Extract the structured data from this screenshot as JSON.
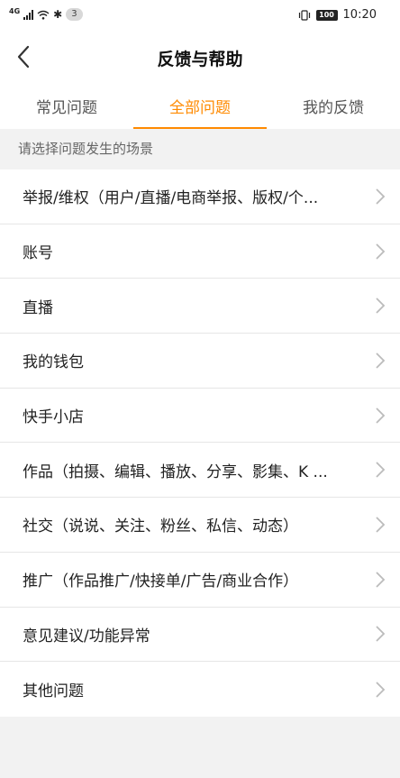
{
  "status_bar": {
    "network": "4G",
    "notification_count": "3",
    "battery": "100",
    "time": "10:20"
  },
  "header": {
    "title": "反馈与帮助"
  },
  "tabs": [
    {
      "label": "常见问题",
      "active": false
    },
    {
      "label": "全部问题",
      "active": true
    },
    {
      "label": "我的反馈",
      "active": false
    }
  ],
  "section_hint": "请选择问题发生的场景",
  "items": [
    {
      "label": "举报/维权（用户/直播/电商举报、版权/个..."
    },
    {
      "label": "账号"
    },
    {
      "label": "直播"
    },
    {
      "label": "我的钱包"
    },
    {
      "label": "快手小店"
    },
    {
      "label": "作品（拍摄、编辑、播放、分享、影集、K ..."
    },
    {
      "label": "社交（说说、关注、粉丝、私信、动态）"
    },
    {
      "label": "推广（作品推广/快接单/广告/商业合作）"
    },
    {
      "label": "意见建议/功能异常"
    },
    {
      "label": "其他问题"
    }
  ],
  "colors": {
    "accent": "#ff8a00",
    "background": "#f2f2f2"
  }
}
